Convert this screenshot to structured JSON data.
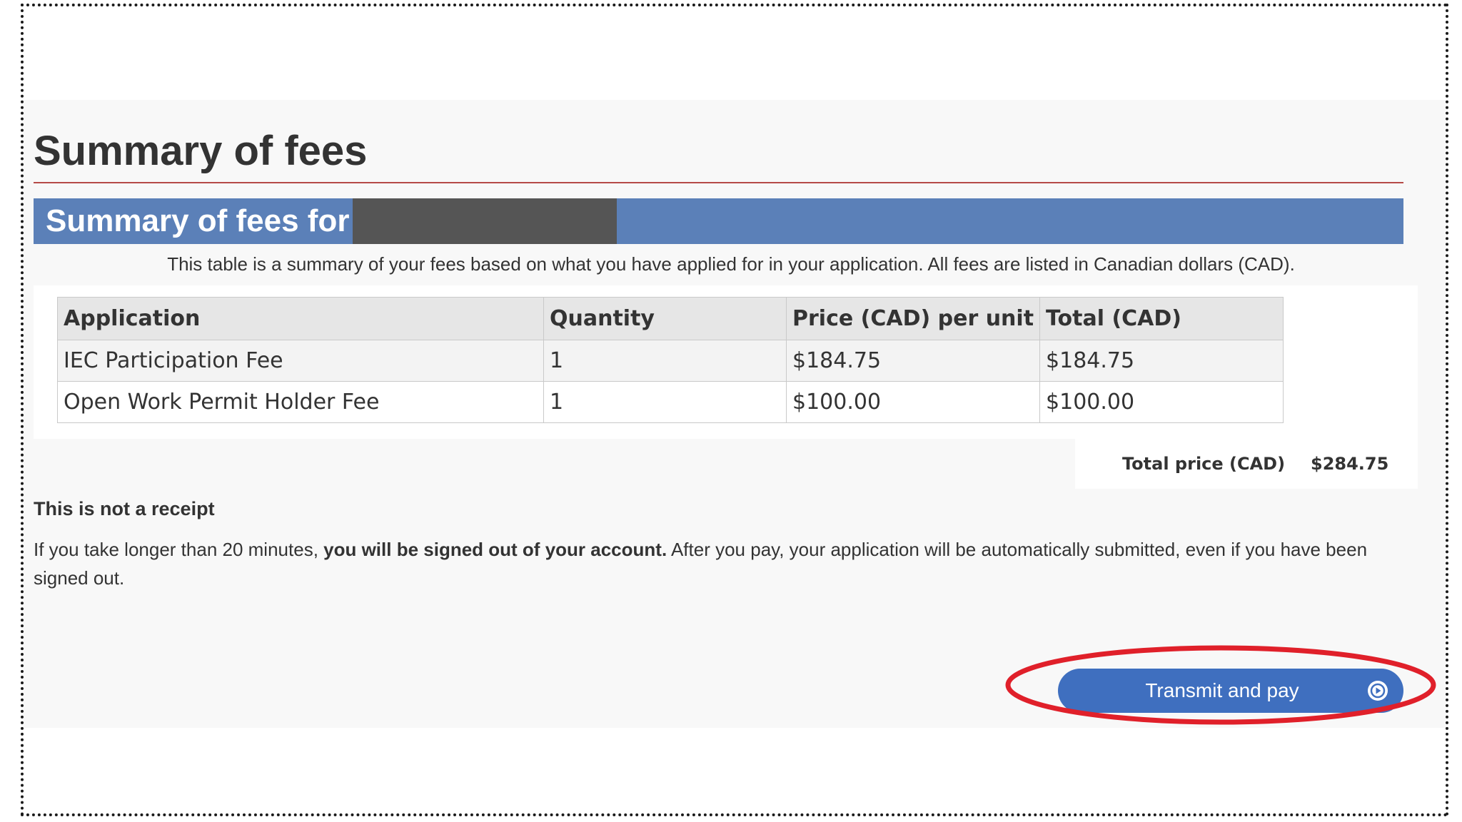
{
  "page": {
    "title": "Summary of fees"
  },
  "section": {
    "header": "Summary of fees for",
    "intro": "This table is a summary of your fees based on what you have applied for in your application. All fees are listed in Canadian dollars (CAD)."
  },
  "table": {
    "headers": [
      "Application",
      "Quantity",
      "Price (CAD) per unit",
      "Total (CAD)"
    ],
    "rows": [
      [
        "IEC Participation Fee",
        "1",
        "$184.75",
        "$184.75"
      ],
      [
        "Open Work Permit Holder Fee",
        "1",
        "$100.00",
        "$100.00"
      ]
    ]
  },
  "total": {
    "label": "Total price (CAD)",
    "value": "$284.75"
  },
  "receipt": {
    "heading": "This is not a receipt",
    "notice_part1": "If you take longer than 20 minutes, ",
    "notice_bold": "you will be signed out of your account.",
    "notice_part2": " After you pay, your application will be automatically submitted, even if you have been signed out."
  },
  "button": {
    "label": "Transmit and pay",
    "icon": "play-circle-icon"
  },
  "colors": {
    "header_bar": "#5b80b8",
    "button": "#3f6fbf",
    "title_rule": "#b54a47",
    "annotation": "#e0202a",
    "redaction": "#555555"
  }
}
